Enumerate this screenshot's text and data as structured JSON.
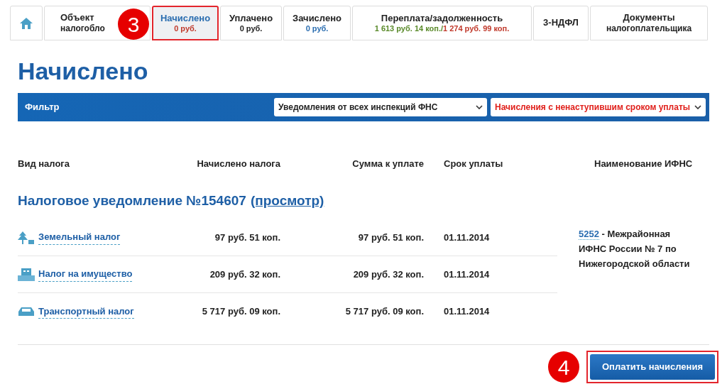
{
  "tabs": [
    {
      "kind": "home",
      "selected": false
    },
    {
      "kind": "text",
      "title": "Объект",
      "subtitle": "налогобло",
      "selected": false
    },
    {
      "kind": "text",
      "title": "Начислено",
      "values": [
        {
          "text": "0 руб.",
          "color": "#c0392b"
        }
      ],
      "selected": true
    },
    {
      "kind": "text",
      "title": "Уплачено",
      "values": [
        {
          "text": "0 руб.",
          "color": "#222222"
        }
      ],
      "selected": false
    },
    {
      "kind": "text",
      "title": "Зачислено",
      "values": [
        {
          "text": "0 руб.",
          "color": "#2a6db0"
        }
      ],
      "selected": false
    },
    {
      "kind": "text",
      "title": "Переплата/задолженность",
      "values": [
        {
          "text": "1 613 руб. 14 коп./",
          "color": "#5a8a2a"
        },
        {
          "text": "1 274 руб. 99 коп.",
          "color": "#c0392b"
        }
      ],
      "selected": false
    },
    {
      "kind": "text",
      "title": "3-НДФЛ",
      "selected": false
    },
    {
      "kind": "text",
      "title": "Документы",
      "subtitle": "налогоплательщика",
      "selected": false
    }
  ],
  "page_title": "Начислено",
  "filter": {
    "label": "Фильтр",
    "selects": [
      {
        "value": "Уведомления от всех инспекций ФНС",
        "color": "#222222"
      },
      {
        "value": "Начисления с ненаступившим сроком уплаты",
        "color": "#e0201b"
      }
    ]
  },
  "table": {
    "columns": [
      "Вид налога",
      "Начислено налога",
      "Сумма к уплате",
      "Срок уплаты",
      "Наименование ИФНС"
    ],
    "group": {
      "title": "Налоговое уведомление №154607",
      "link": "(просмотр)"
    },
    "rows": [
      {
        "kind": "land",
        "name": "Земельный налог",
        "accrued": "97 руб. 51 коп.",
        "due": "97 руб. 51 коп.",
        "date": "01.11.2014"
      },
      {
        "kind": "property",
        "name": "Налог на имущество",
        "accrued": "209 руб. 32 коп.",
        "due": "209 руб. 32 коп.",
        "date": "01.11.2014"
      },
      {
        "kind": "transport",
        "name": "Транспортный налог",
        "accrued": "5 717 руб. 09 коп.",
        "due": "5 717 руб. 09 коп.",
        "date": "01.11.2014"
      }
    ],
    "ifns": {
      "code": "5252",
      "text": " - Межрайонная ИФНС России № 7 по Нижегородской области"
    }
  },
  "pay_button": "Оплатить начисления",
  "annotations": [
    "3",
    "4"
  ]
}
